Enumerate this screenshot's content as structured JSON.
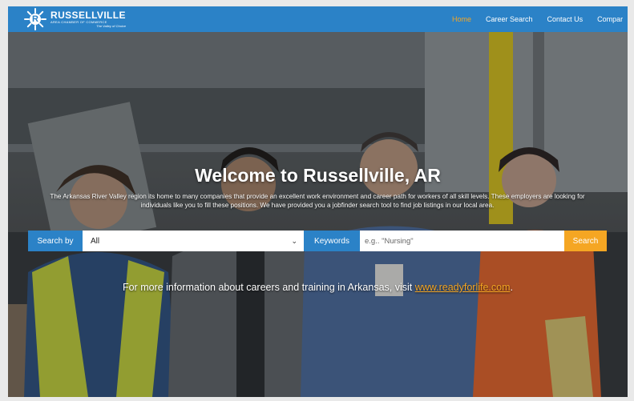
{
  "brand": {
    "logo_letter": "R",
    "name": "RUSSELLVILLE",
    "subname": "AREA CHAMBER OF COMMERCE",
    "tagline": "The Valley of Choice"
  },
  "nav": {
    "items": [
      {
        "label": "Home",
        "active": true
      },
      {
        "label": "Career Search",
        "active": false
      },
      {
        "label": "Contact Us",
        "active": false
      },
      {
        "label": "Compar",
        "active": false
      }
    ]
  },
  "hero": {
    "title": "Welcome to Russellville, AR",
    "subtitle": "The Arkansas River Valley region its home to many companies that provide an excellent work environment and career path for workers of all skill levels. These employers are looking for individuals like you to fill these positions. We have provided you a jobfinder search tool to find job listings in our local area."
  },
  "search": {
    "search_by_label": "Search by",
    "search_by_value": "All",
    "keywords_label": "Keywords",
    "keywords_placeholder": "e.g.. \"Nursing\"",
    "button_label": "Search"
  },
  "info": {
    "text": "For more information about careers and training in Arkansas, visit ",
    "link_text": "www.readyforlife.com",
    "suffix": "."
  },
  "colors": {
    "primary": "#2b82c7",
    "accent": "#f5a623",
    "text_light": "#ffffff"
  },
  "icons": {
    "logo": "sunburst-logo-icon",
    "dropdown": "chevron-down-icon"
  }
}
